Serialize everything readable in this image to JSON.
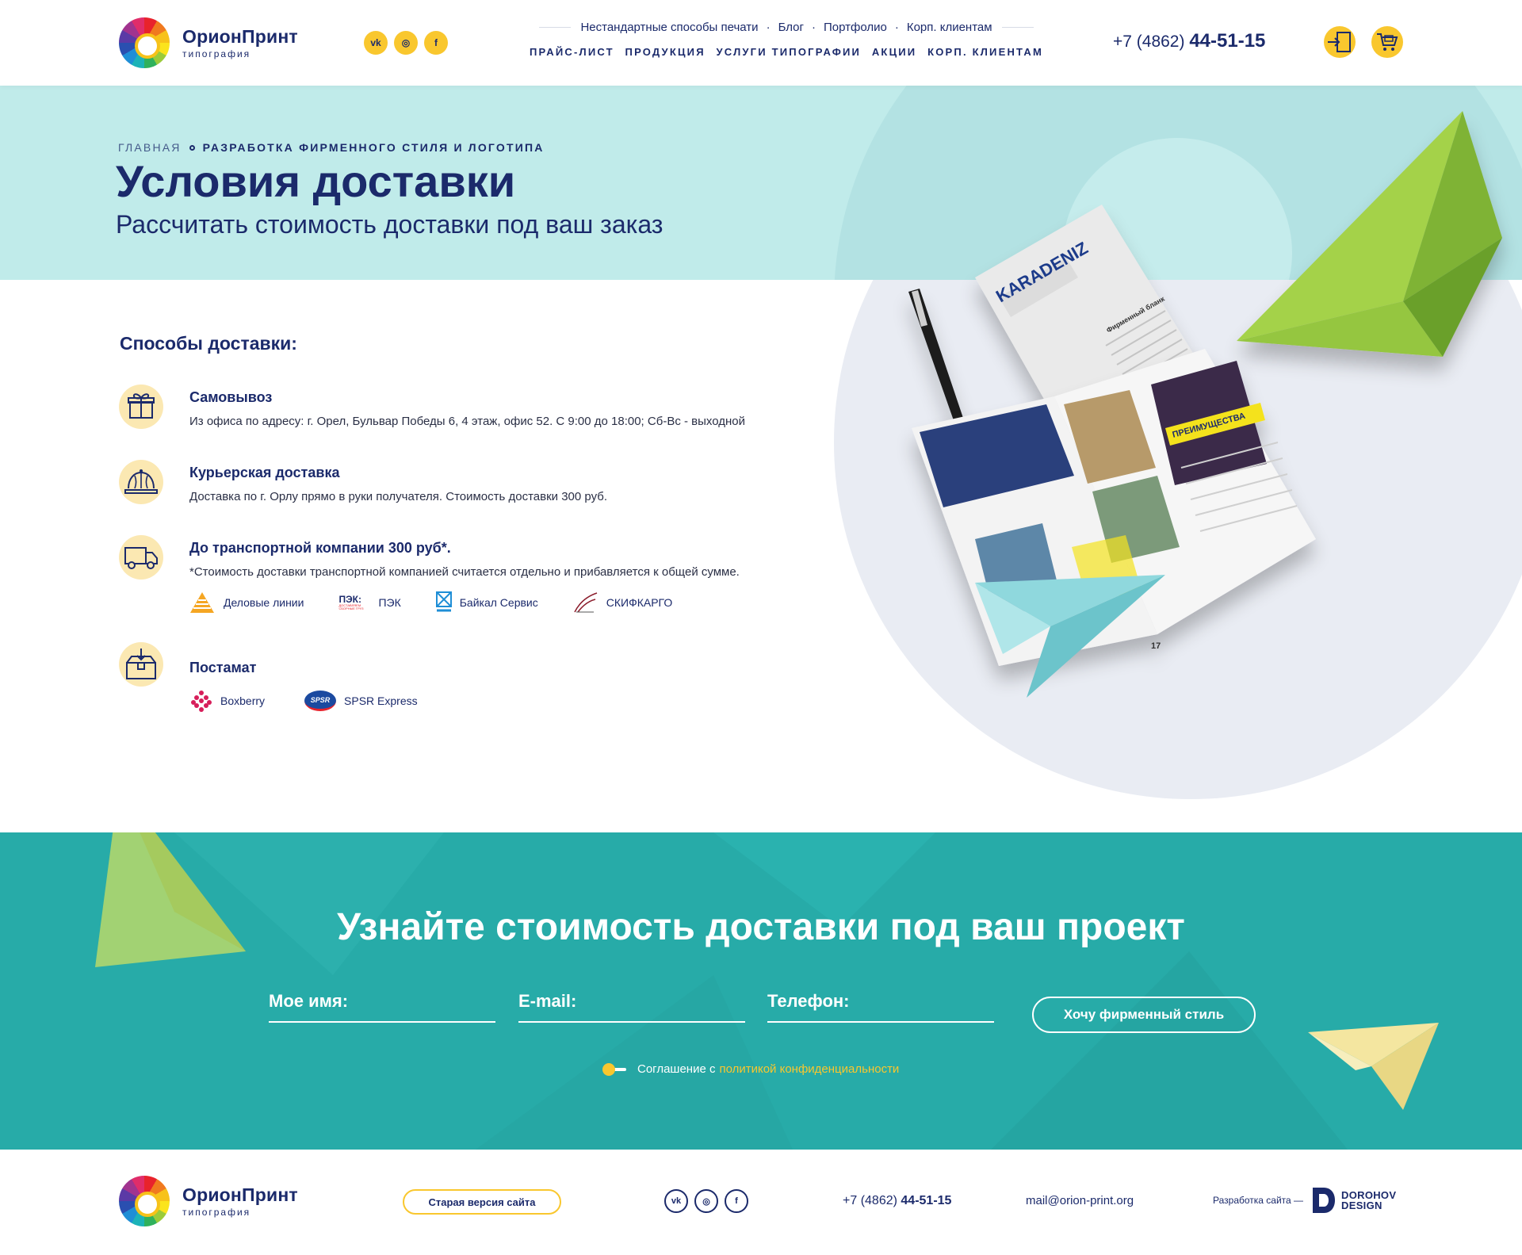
{
  "brand": {
    "name": "ОрионПринт",
    "sub": "типография"
  },
  "header": {
    "social": [
      {
        "id": "vk",
        "glyph": "vk"
      },
      {
        "id": "instagram",
        "glyph": "◎"
      },
      {
        "id": "facebook",
        "glyph": "f"
      }
    ],
    "top_nav": [
      "Нестандартные способы печати",
      "Блог",
      "Портфолио",
      "Корп. клиентам"
    ],
    "main_nav": [
      "ПРАЙС-ЛИСТ",
      "ПРОДУКЦИЯ",
      "УСЛУГИ ТИПОГРАФИИ",
      "АКЦИИ",
      "КОРП. КЛИЕНТАМ"
    ],
    "phone_prefix": "+7 (4862)",
    "phone_number": "44-51-15"
  },
  "breadcrumb": {
    "home": "ГЛАВНАЯ",
    "current": "РАЗРАБОТКА ФИРМЕННОГО СТИЛЯ И ЛОГОТИПА"
  },
  "hero": {
    "title": "Условия доставки",
    "subtitle": "Рассчитать стоимость доставки под ваш заказ"
  },
  "delivery": {
    "title": "Способы доставки:",
    "methods": [
      {
        "icon": "gift-box-icon",
        "title": "Самовывоз",
        "desc": "Из офиса по адресу: г. Орел, Бульвар Победы 6, 4 этаж, офис 52.  С 9:00  до 18:00; Сб-Вс - выходной"
      },
      {
        "icon": "courier-cap-icon",
        "title": "Курьерская доставка",
        "desc": "Доставка по г. Орлу прямо в руки получателя. Стоимость доставки 300 руб."
      },
      {
        "icon": "truck-icon",
        "title": "До транспортной компании 300 руб*.",
        "desc": "*Стоимость доставки транспортной компанией считается отдельно и прибавляется к общей сумме."
      },
      {
        "icon": "parcel-box-icon",
        "title": "Постамат",
        "desc": ""
      }
    ],
    "transport_companies": [
      "Деловые линии",
      "ПЭК",
      "Байкал Сервис",
      "СКИФКАРГО"
    ],
    "pek_logo_text": "ПЭК:",
    "pek_logo_sub": "ДОСТАВЛЯЕМ СБОРНЫЕ ГРУЗ",
    "postamats": [
      "Boxberry",
      "SPSR Express"
    ],
    "spsr_logo_text": "SPSR"
  },
  "illustration": {
    "letterhead_brand": "KARADENIZ",
    "letterhead_title": "Фирменный бланк",
    "brochure_banner": "ПРЕИМУЩЕСТВА",
    "page_number": "17"
  },
  "form": {
    "title": "Узнайте стоимость доставки под ваш проект",
    "name_placeholder": "Мое имя:",
    "email_placeholder": "E-mail:",
    "phone_placeholder": "Телефон:",
    "submit": "Хочу фирменный стиль",
    "agreement": "Соглашение с",
    "agreement_link": "политикой конфиденциальности"
  },
  "footer": {
    "old_version": "Старая версия сайта",
    "phone_prefix": "+7 (4862)",
    "phone_number": "44-51-15",
    "email": "mail@orion-print.org",
    "dev_label": "Разработка сайта —",
    "dev_name_1": "DOROHOV",
    "dev_name_2": "DESIGN"
  },
  "colors": {
    "navy": "#1b2a6b",
    "yellow": "#f9c72e",
    "teal": "#27aba8",
    "hero": "#c0ebea",
    "green": "#8dc63f"
  }
}
